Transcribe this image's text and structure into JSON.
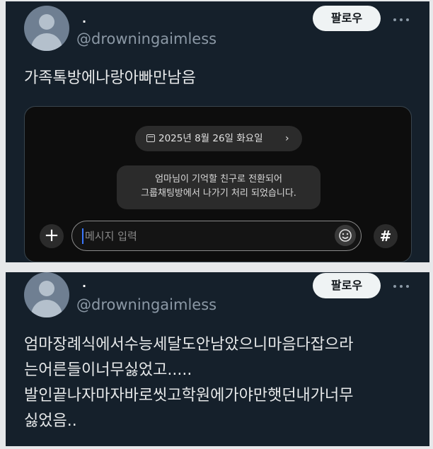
{
  "post1": {
    "display_name": "·",
    "handle": "@drowningaimless",
    "follow_label": "팔로우",
    "text_lines": [
      "가족톡방에나랑아빠만남음"
    ],
    "chat": {
      "date_label": "2025년 8월 26일 화요일",
      "system_message": [
        "엄마님이 기억할 친구로 전환되어",
        "그룹채팅방에서 나가기 처리 되었습니다."
      ],
      "input_placeholder": "메시지 입력",
      "plus_label": "+",
      "hash_label": "#"
    }
  },
  "post2": {
    "display_name": "·",
    "handle": "@drowningaimless",
    "follow_label": "팔로우",
    "text_lines": [
      "엄마장례식에서수능세달도안남았으니마음다잡으라",
      "는어른들이너무싫었고.....",
      "발인끝나자마자바로씻고학원에가야만햇던내가너무",
      "싫었음.."
    ]
  },
  "icons": [
    "avatar",
    "more-icon",
    "calendar-icon",
    "chevron-right-icon",
    "plus-icon",
    "emoji-icon",
    "hash-icon"
  ]
}
